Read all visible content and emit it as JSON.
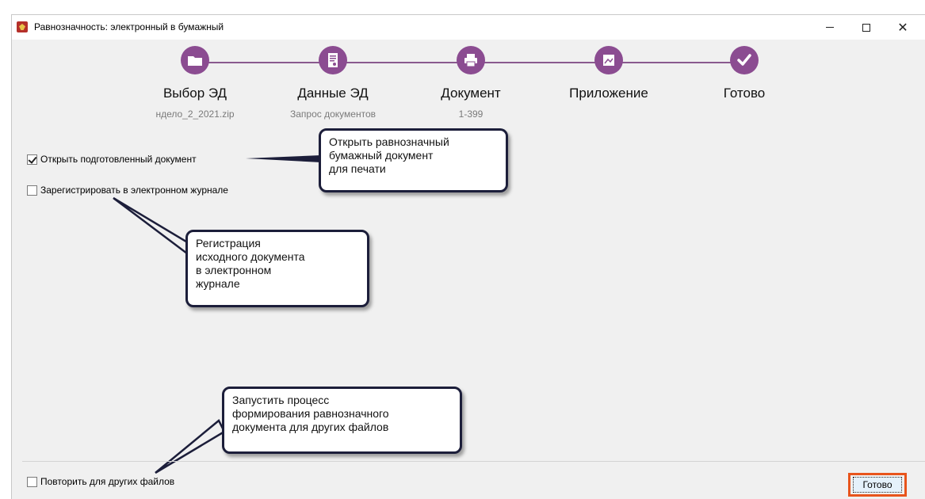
{
  "window": {
    "title": "Равнозначность: электронный в бумажный",
    "controls": [
      "minimize",
      "maximize",
      "close"
    ]
  },
  "steps": [
    {
      "label": "Выбор ЭД",
      "sub": "ндело_2_2021.zip",
      "icon": "folder-icon"
    },
    {
      "label": "Данные ЭД",
      "sub": "Запрос документов",
      "icon": "document-certificate-icon"
    },
    {
      "label": "Документ",
      "sub": "1-399",
      "icon": "printer-icon"
    },
    {
      "label": "Приложение",
      "sub": "",
      "icon": "image-attachment-icon"
    },
    {
      "label": "Готово",
      "sub": "",
      "icon": "checkmark-icon"
    }
  ],
  "options": {
    "open_document": {
      "label": "Открыть подготовленный документ",
      "checked": true
    },
    "register_journal": {
      "label": "Зарегистрировать в электронном журнале",
      "checked": false
    },
    "repeat_other_files": {
      "label": "Повторить для других файлов",
      "checked": false
    }
  },
  "callouts": {
    "open_doc": [
      "Открыть равнозначный",
      "бумажный документ",
      "для печати"
    ],
    "register": [
      "Регистрация",
      "исходного документа",
      "в электронном",
      "журнале"
    ],
    "repeat": [
      "Запустить процесс",
      "формирования равнозначного",
      "документа для других файлов"
    ]
  },
  "buttons": {
    "done": "Готово"
  },
  "colors": {
    "accent": "#8b4c91",
    "highlight": "#e8541c",
    "callout_border": "#1c1e3a"
  }
}
